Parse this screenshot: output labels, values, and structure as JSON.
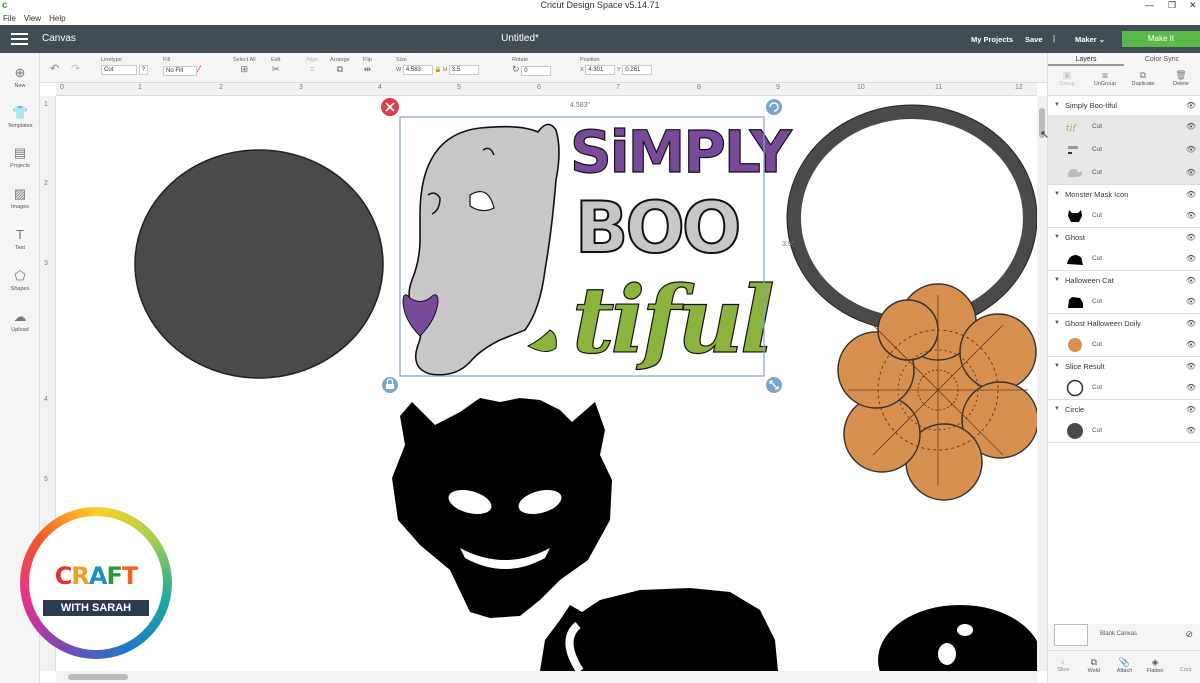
{
  "titlebar": {
    "app_title": "Cricut Design Space  v5.14.71",
    "logo": "c"
  },
  "menubar": {
    "items": [
      "File",
      "View",
      "Help"
    ]
  },
  "header": {
    "section": "Canvas",
    "document": "Untitled*",
    "my_projects": "My Projects",
    "save": "Save",
    "separator": "|",
    "machine": "Maker",
    "make_it": "Make It"
  },
  "toolbar": {
    "linetype_label": "Linetype",
    "linetype_value": "Cut",
    "fill_label": "Fill",
    "fill_value": "No Fill",
    "select_all": "Select All",
    "edit": "Edit",
    "align": "Align",
    "arrange": "Arrange",
    "flip": "Flip",
    "size": "Size",
    "w_label": "W",
    "w_value": "4.583",
    "h_label": "H",
    "h_value": "3.5",
    "rotate": "Rotate",
    "rotate_value": "0",
    "position": "Position",
    "x_label": "X",
    "x_value": "4.301",
    "y_label": "Y",
    "y_value": "0.261"
  },
  "leftnav": {
    "items": [
      {
        "label": "New",
        "icon": "plus-icon"
      },
      {
        "label": "Templates",
        "icon": "shirt-icon"
      },
      {
        "label": "Projects",
        "icon": "projects-icon"
      },
      {
        "label": "Images",
        "icon": "image-icon"
      },
      {
        "label": "Text",
        "icon": "text-icon"
      },
      {
        "label": "Shapes",
        "icon": "shapes-icon"
      },
      {
        "label": "Upload",
        "icon": "upload-icon"
      }
    ]
  },
  "ruler": {
    "h": [
      "0",
      "1",
      "2",
      "3",
      "4",
      "5",
      "6",
      "7",
      "8",
      "9",
      "10",
      "11",
      "12"
    ],
    "v": [
      "1",
      "2",
      "3",
      "4",
      "5"
    ]
  },
  "canvas": {
    "width_readout": "4.583\"",
    "height_readout": "3.5\"",
    "design": {
      "line1": "SiMPLY",
      "line2": "BOO",
      "line3": "tiful"
    }
  },
  "panel": {
    "tabs": [
      "Layers",
      "Color Sync"
    ],
    "tools": [
      "Group",
      "UnGroup",
      "Duplicate",
      "Delete"
    ],
    "layers": [
      {
        "name": "Simply Boo-tiful",
        "rows": [
          "Cut",
          "Cut",
          "Cut"
        ]
      },
      {
        "name": "Monster Mask Icon",
        "rows": [
          "Cut"
        ]
      },
      {
        "name": "Ghost",
        "rows": [
          "Cut"
        ]
      },
      {
        "name": "Halloween Cat",
        "rows": [
          "Cut"
        ]
      },
      {
        "name": "Ghost Halloween Doily",
        "rows": [
          "Cut"
        ]
      },
      {
        "name": "Slice Result",
        "rows": [
          "Cut"
        ]
      },
      {
        "name": "Circle",
        "rows": [
          "Cut"
        ]
      }
    ],
    "blank_canvas": "Blank Canvas",
    "bottom_tools": [
      "Slice",
      "Weld",
      "Attach",
      "Flatten",
      "Cont"
    ]
  },
  "watermark": {
    "craft": [
      "C",
      "R",
      "A",
      "F",
      "T"
    ],
    "with": "WITH SARAH"
  },
  "colors": {
    "header": "#414d55",
    "make_it": "#5bb94a",
    "selection": "#7aa6cc",
    "purple": "#7a4a9a",
    "green": "#8ab43c",
    "ghost": "#c8c6c8",
    "doily": "#d89050",
    "shape_dark": "#4a4a4c"
  }
}
